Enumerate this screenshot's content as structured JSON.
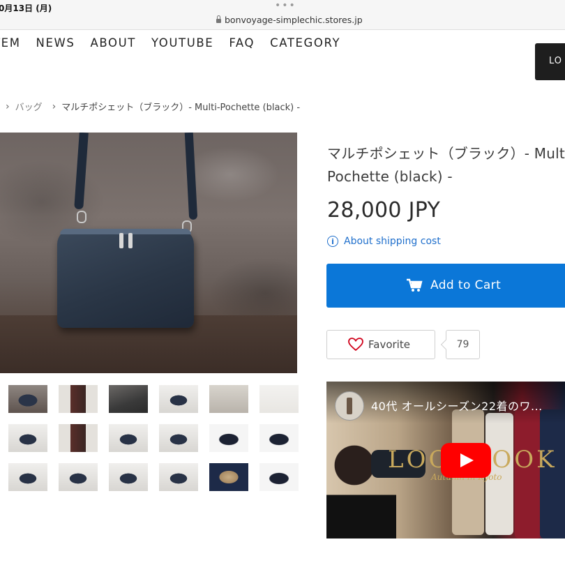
{
  "status": {
    "time": "0月13日 (月)",
    "url": "bonvoyage-simplechic.stores.jp"
  },
  "nav": {
    "items": [
      "TEM",
      "NEWS",
      "ABOUT",
      "YOUTUBE",
      "FAQ",
      "CATEGORY"
    ],
    "right_button": "LO"
  },
  "breadcrumb": {
    "items": [
      "バッグ",
      "マルチポシェット（ブラック）- Multi-Pochette (black) -"
    ]
  },
  "product": {
    "title": "マルチポシェット（ブラック）- Multi-Pochette (black) -",
    "price": "28,000 JPY",
    "shipping_link": "About shipping cost",
    "add_to_cart": "Add to Cart",
    "favorite": "Favorite",
    "favorite_count": "79"
  },
  "video": {
    "title": "40代 オールシーズン22着のワ...",
    "overlay_title": "LOOKBOOK",
    "overlay_subtitle": "Autumn in Kyoto"
  },
  "colors": {
    "accent": "#0b77d8",
    "link": "#1f6fcc",
    "dark_button": "#1e1e1e",
    "heart": "#d0021b"
  },
  "thumbnails": [
    "bag-front",
    "dress-outfit",
    "bag-hanging",
    "bag-flat",
    "strap",
    "outfit-white",
    "bag-small",
    "dress-outfit-2",
    "bag-angle",
    "bag-closed",
    "bag-inside",
    "bag-open",
    "bag-back",
    "bag-stack",
    "bag-side",
    "bag-pocket",
    "bag-lining",
    "bag-corner"
  ]
}
